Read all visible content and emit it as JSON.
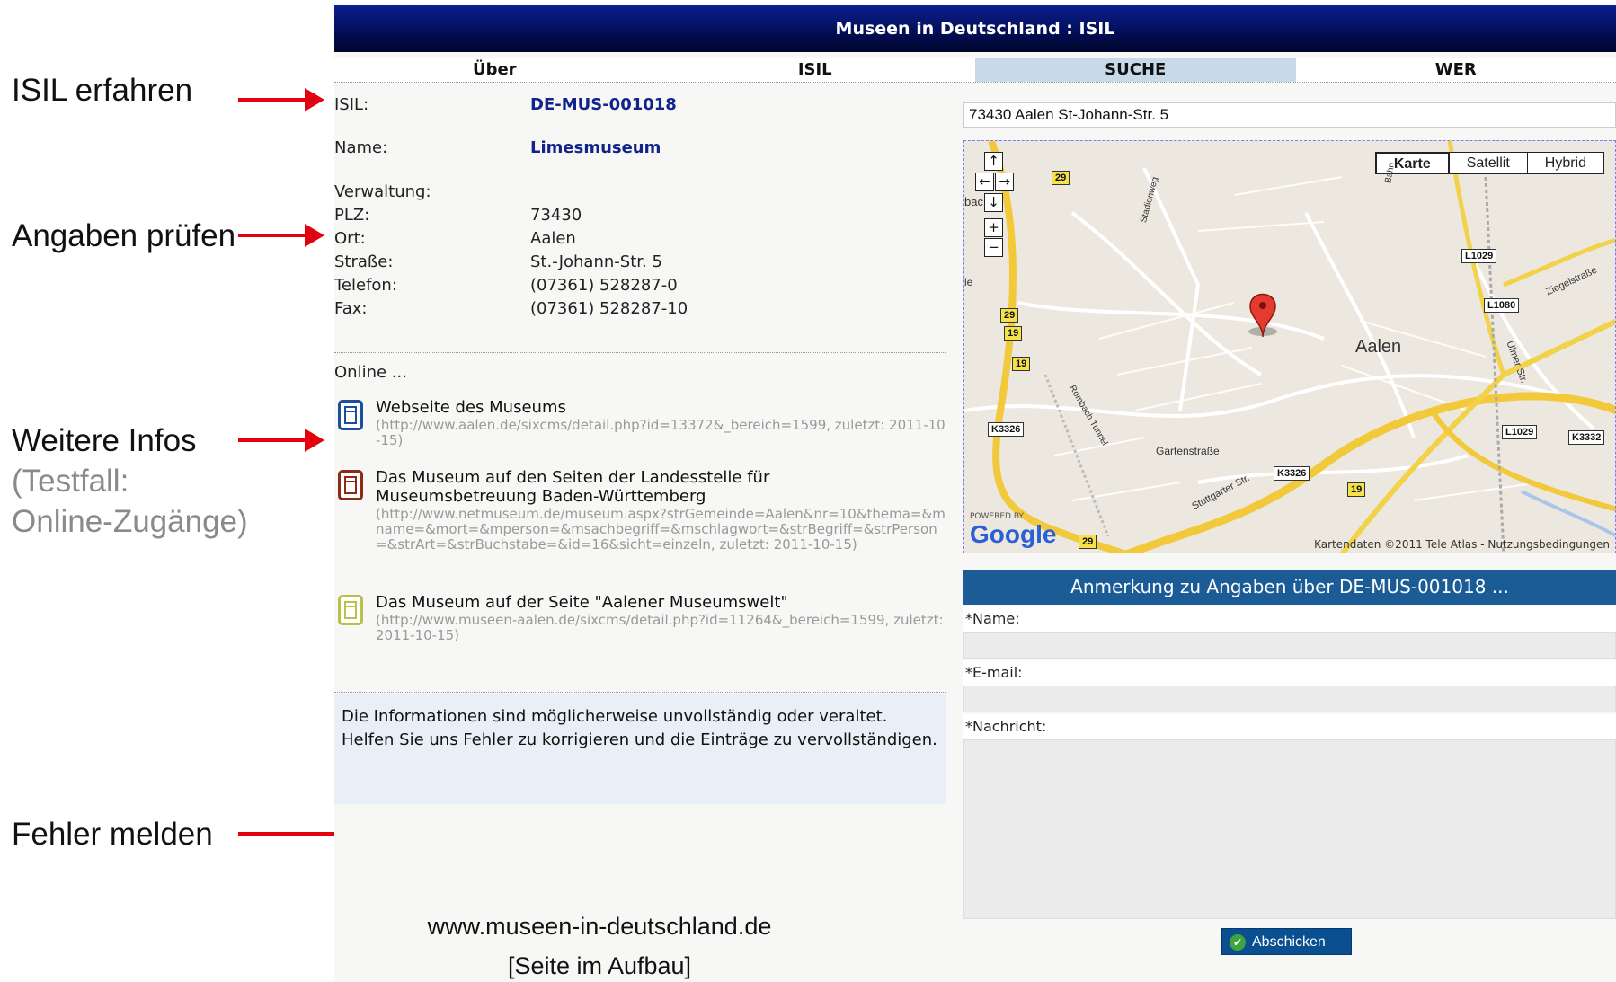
{
  "annotations": {
    "isil": "ISIL erfahren",
    "check": "Angaben prüfen",
    "more": "Weitere Infos",
    "testcase_line1": "(Testfall:",
    "testcase_line2": "Online-Zugänge)",
    "report": "Fehler melden"
  },
  "header": {
    "title": "Museen in Deutschland : ISIL"
  },
  "nav": {
    "items": [
      "Über",
      "ISIL",
      "SUCHE",
      "WER"
    ],
    "active": "SUCHE"
  },
  "record": {
    "isil_label": "ISIL:",
    "isil_value": "DE-MUS-001018",
    "name_label": "Name:",
    "name_value": "Limesmuseum",
    "verwaltung_label": "Verwaltung:",
    "plz_label": "PLZ:",
    "plz_value": "73430",
    "ort_label": "Ort:",
    "ort_value": "Aalen",
    "strasse_label": "Straße:",
    "strasse_value": "St.-Johann-Str. 5",
    "telefon_label": "Telefon:",
    "telefon_value": "(07361) 528287-0",
    "fax_label": "Fax:",
    "fax_value": "(07361) 528287-10"
  },
  "online": {
    "heading": "Online ...",
    "items": [
      {
        "title": "Webseite des Museums",
        "url": "(http://www.aalen.de/sixcms/detail.php?id=13372&_bereich=1599, zuletzt: 2011-10-15)",
        "color": "#1b4f9a"
      },
      {
        "title": "Das Museum auf den Seiten der Landesstelle für Museumsbetreuung Baden-Württemberg",
        "url": "(http://www.netmuseum.de/museum.aspx?strGemeinde=Aalen&nr=10&thema=&mname=&mort=&mperson=&msachbegriff=&mschlagwort=&strBegriff=&strPerson=&strArt=&strBuchstabe=&id=16&sicht=einzeln, zuletzt: 2011-10-15)",
        "color": "#8b2a16"
      },
      {
        "title": "Das Museum auf der Seite \"Aalener Museumswelt\"",
        "url": "(http://www.museen-aalen.de/sixcms/detail.php?id=11264&_bereich=1599, zuletzt: 2011-10-15)",
        "color": "#b8c24a"
      }
    ]
  },
  "notice": {
    "text": "Die Informationen sind möglicherweise unvollständig oder veraltet. Helfen Sie uns Fehler zu korrigieren und die Einträge zu vervollständigen."
  },
  "footer": {
    "url": "www.museen-in-deutschland.de",
    "status": "[Seite im Aufbau]"
  },
  "map": {
    "address": "73430 Aalen St-Johann-Str. 5",
    "types": [
      "Karte",
      "Satellit",
      "Hybrid"
    ],
    "selected_type": "Karte",
    "city_label": "Aalen",
    "streets": [
      "Gartenstraße",
      "Stuttgarter Str.",
      "Ziegelstraße",
      "Ulmer Str.",
      "Stadionweg",
      "Rombach Tunnel",
      "Bahn"
    ],
    "signs": [
      "29",
      "19",
      "L1029",
      "L1080",
      "K3326",
      "K3332",
      "29",
      "19",
      "K3326",
      "19",
      "L1029",
      "29"
    ],
    "powered_by": "POWERED BY",
    "logo": "Google",
    "copyright": "Kartendaten ©2011 Tele Atlas - Nutzungsbedingungen",
    "cut_label": "bac",
    "cut_label2": "le"
  },
  "form": {
    "header": "Anmerkung zu Angaben über DE-MUS-001018 ...",
    "name_label": "*Name:",
    "email_label": "*E-mail:",
    "message_label": "*Nachricht:",
    "submit_label": "Abschicken"
  },
  "colors": {
    "arrow": "#e3000f",
    "header_bg": "#020a4a",
    "nav_active": "#c8d9e8",
    "form_header": "#1b5c97",
    "link": "#10248c"
  }
}
